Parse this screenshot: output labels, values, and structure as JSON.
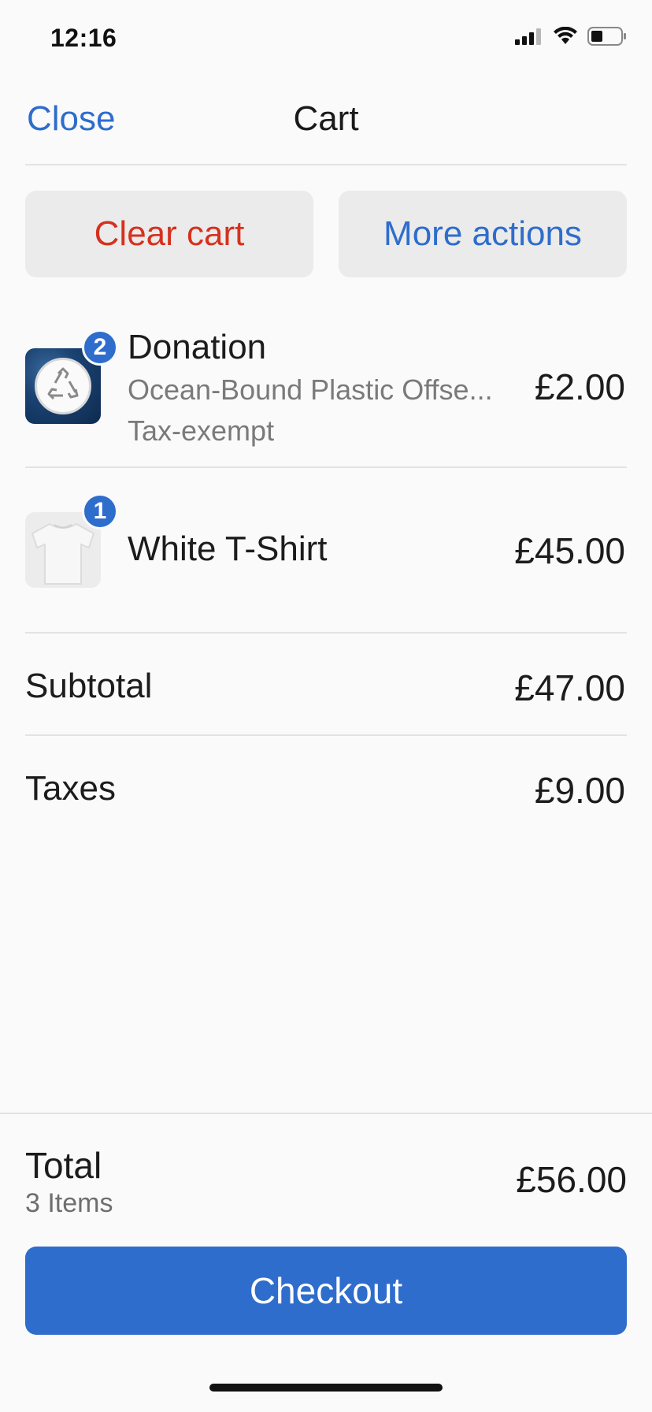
{
  "status_bar": {
    "time": "12:16",
    "icons": [
      "signal-icon",
      "wifi-icon",
      "battery-icon"
    ]
  },
  "header": {
    "close_label": "Close",
    "title": "Cart"
  },
  "actions": {
    "clear_label": "Clear cart",
    "more_label": "More actions"
  },
  "items": [
    {
      "name": "Donation",
      "variant": "Ocean-Bound Plastic Offse...",
      "note": "Tax-exempt",
      "price": "£2.00",
      "quantity": "2",
      "thumbnail_icon": "recycle-icon"
    },
    {
      "name": "White T-Shirt",
      "price": "£45.00",
      "quantity": "1",
      "thumbnail_icon": "t-shirt-icon"
    }
  ],
  "summary": {
    "subtotal_label": "Subtotal",
    "subtotal_value": "£47.00",
    "taxes_label": "Taxes",
    "taxes_value": "£9.00"
  },
  "footer": {
    "total_label": "Total",
    "items_count": "3 Items",
    "total_value": "£56.00",
    "checkout_label": "Checkout"
  },
  "colors": {
    "accent": "#2e6dcc",
    "destructive": "#d6311e",
    "button_bg": "#ebebeb",
    "background": "#fafafa"
  }
}
